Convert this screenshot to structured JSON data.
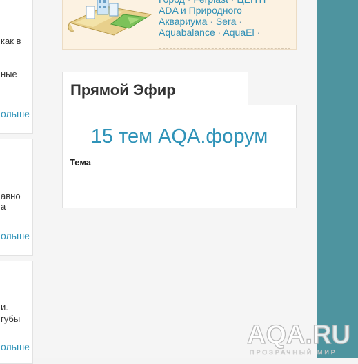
{
  "left_cards": [
    {
      "fragments": [
        "как в",
        "ные"
      ],
      "more": "ольше"
    },
    {
      "fragments": [
        "авно",
        "а"
      ],
      "more": "ольше"
    },
    {
      "fragments": [
        "и.",
        "губы"
      ],
      "more": "ольше"
    }
  ],
  "partners": {
    "links": [
      "Город",
      "Ferplast",
      "ЦЕНТР ADA и Природного Аквариума",
      "Sera",
      "Aquabalance",
      "AquaEl"
    ],
    "separator": " · "
  },
  "live": {
    "title": "Прямой Эфир",
    "count_link": "15 тем AQA.форум",
    "column_header": "Тема"
  },
  "watermark": {
    "logo": "AQA.RU",
    "tagline": "ПРОЗРАЧНЫЙ МИР"
  },
  "colors": {
    "accent": "#2f93b8",
    "sidebar": "#4e949f"
  }
}
